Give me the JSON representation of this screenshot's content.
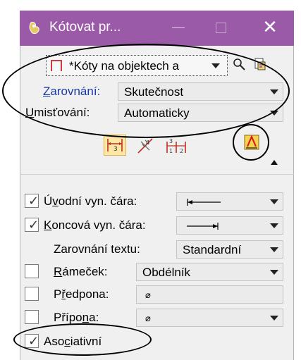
{
  "window": {
    "title": "Kótovat pr...",
    "min_glyph": "—",
    "close_glyph": "✕"
  },
  "style_selector": {
    "value": "*Kóty na objektech a"
  },
  "alignment": {
    "label": "Zarovnání:",
    "label_access_key": "Z",
    "label_rest": "arovnání:",
    "value": "Skutečnost"
  },
  "placement": {
    "label": "Umisťování:",
    "label_access_key": "U",
    "label_rest": "misťování:",
    "value": "Automaticky"
  },
  "options": {
    "start_ext_line": {
      "label_pre": "Ú",
      "label_key": "v",
      "label_post": "odní vyn. čára:",
      "checked": true,
      "value_glyph": "⇤"
    },
    "end_ext_line": {
      "label_pre": "",
      "label_key": "K",
      "label_post": "oncová vyn. čára:",
      "checked": true,
      "value_glyph": "⇥"
    },
    "text_alignment": {
      "label": "Zarovnání textu:",
      "value": "Standardní"
    },
    "frame": {
      "label_pre": "",
      "label_key": "R",
      "label_post": "ámeček:",
      "checked": false,
      "value": "Obdélník"
    },
    "prefix": {
      "label_pre": "P",
      "label_key": "ř",
      "label_post": "edpona:",
      "checked": false,
      "value": "⌀"
    },
    "suffix": {
      "label_pre": "Přípo",
      "label_key": "n",
      "label_post": "a:",
      "checked": false,
      "value": "⌀"
    },
    "associative": {
      "label_pre": "Aso",
      "label_key": "c",
      "label_post": "iativní",
      "checked": true
    }
  },
  "colors": {
    "title_bar": "#9a5aa8",
    "label_blue": "#1a3aa6",
    "panel_bg": "#f0f0f0"
  }
}
